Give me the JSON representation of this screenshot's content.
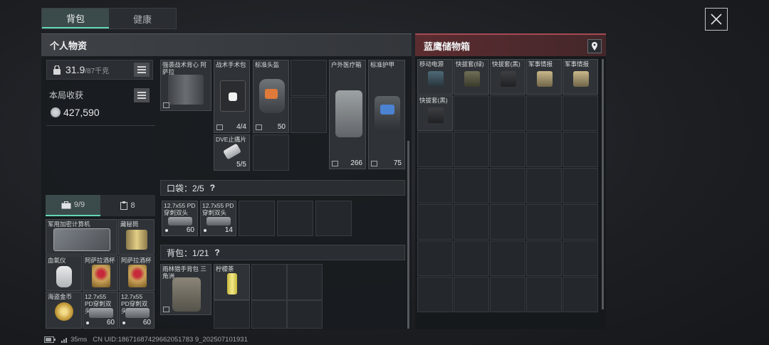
{
  "tabs": [
    {
      "label": "背包",
      "active": true
    },
    {
      "label": "健康",
      "active": false
    }
  ],
  "personal": {
    "title": "个人物资",
    "weight_value": "31.9",
    "weight_max": "/87千克",
    "harvest_label": "本局收获",
    "harvest_value": "427,590",
    "mini_tabs": [
      {
        "label": "9/9",
        "icon": "briefcase-icon"
      },
      {
        "label": "8",
        "icon": "clipboard-icon"
      }
    ]
  },
  "safe_items": [
    {
      "name": "军用加密计算机",
      "count": ""
    },
    {
      "name": "藏秘筒",
      "count": ""
    },
    {
      "name": "血氧仪",
      "count": ""
    },
    {
      "name": "阿萨拉酒杯",
      "count": ""
    },
    {
      "name": "阿萨拉酒杯",
      "count": ""
    },
    {
      "name": "海盗金币",
      "count": ""
    },
    {
      "name": "12.7x55 PD穿刺双头",
      "count": "60"
    },
    {
      "name": "12.7x55 PD穿刺双头",
      "count": "60"
    }
  ],
  "equipment": [
    {
      "name": "强袭战术背心 阿萨拉",
      "value": ""
    },
    {
      "name": "战术手术包",
      "value": "4/4"
    },
    {
      "name": "标准头盔",
      "value": "50"
    },
    {
      "name": "户外医疗箱",
      "value": "266"
    },
    {
      "name": "标准护甲",
      "value": "75"
    },
    {
      "name": "DVE止痛片",
      "value": "5/5"
    }
  ],
  "pocket": {
    "label": "口袋",
    "capacity": "2/5",
    "help": "?",
    "items": [
      {
        "name": "12.7x55 PD穿刺双头",
        "count": "60"
      },
      {
        "name": "12.7x55 PD穿刺双头",
        "count": "14"
      }
    ]
  },
  "backpack": {
    "label": "背包",
    "capacity": "1/21",
    "help": "?",
    "items": [
      {
        "name": "雨林猎手背包 三角洲",
        "count": ""
      },
      {
        "name": "柠檬茶",
        "count": ""
      }
    ]
  },
  "storage": {
    "title": "蓝鹰储物箱",
    "items": [
      {
        "name": "移动电源"
      },
      {
        "name": "快拔套(绿)"
      },
      {
        "name": "快拔套(黑)"
      },
      {
        "name": "军事情报"
      },
      {
        "name": "军事情报"
      },
      {
        "name": "快拔套(黑)"
      }
    ]
  },
  "status_bar": {
    "ping": "35ms",
    "uid": "CN UID:18671687429662051783 9_202507101931"
  },
  "colors": {
    "accent": "#64d6b8",
    "storage_accent": "#a64a52"
  }
}
